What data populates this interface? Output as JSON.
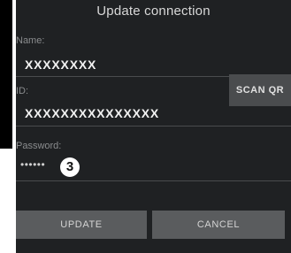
{
  "dialog": {
    "title": "Update connection"
  },
  "fields": {
    "name": {
      "label": "Name:",
      "value": "XXXXXXXX"
    },
    "id": {
      "label": "ID:",
      "value": "XXXXXXXXXXXXXXX",
      "scan_label": "SCAN QR"
    },
    "password": {
      "label": "Password:",
      "masked_value": "••••••",
      "badge": "3"
    }
  },
  "buttons": {
    "update": "UPDATE",
    "cancel": "CANCEL"
  },
  "colors": {
    "dialog_bg": "#1f2123",
    "button_bg": "#5a5c5e",
    "scan_bg": "#4a4c4e"
  }
}
